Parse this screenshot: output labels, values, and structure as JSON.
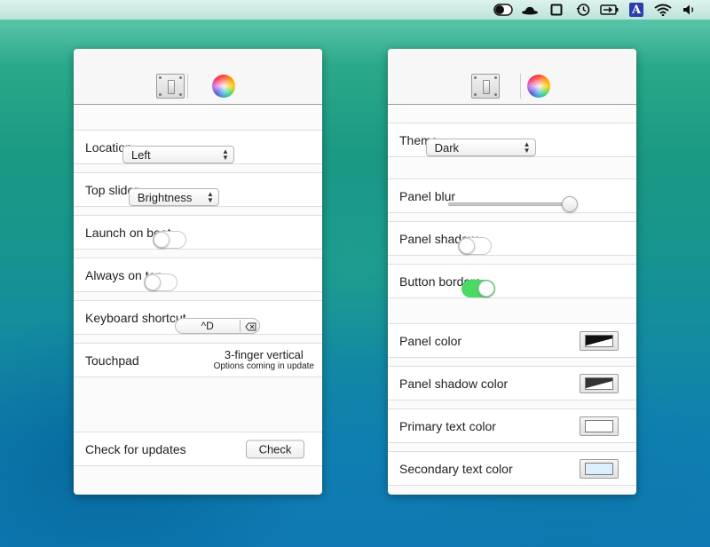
{
  "menubar": {
    "icons": [
      "toggle-icon",
      "bowler-hat-icon",
      "square-icon",
      "time-machine-icon",
      "battery-icon",
      "a-icon",
      "wifi-icon",
      "volume-icon"
    ],
    "a_glyph": "A"
  },
  "left_panel": {
    "location": {
      "label": "Location",
      "value": "Left"
    },
    "top_slider": {
      "label": "Top slider",
      "value": "Brightness"
    },
    "launch_on_boot": {
      "label": "Launch on boot",
      "on": false
    },
    "always_on_top": {
      "label": "Always on top",
      "on": false
    },
    "keyboard_shortcut": {
      "label": "Keyboard shortcut",
      "value": "^D"
    },
    "touchpad": {
      "label": "Touchpad",
      "value": "3-finger vertical",
      "note": "Options coming in update"
    },
    "check_for_updates": {
      "label": "Check for updates",
      "button": "Check"
    }
  },
  "right_panel": {
    "theme": {
      "label": "Theme",
      "value": "Dark"
    },
    "panel_blur": {
      "label": "Panel blur",
      "value": 1.0
    },
    "panel_shadow": {
      "label": "Panel shadow",
      "on": false
    },
    "button_borders": {
      "label": "Button borders",
      "on": true
    },
    "panel_color": {
      "label": "Panel color"
    },
    "panel_shadow_color": {
      "label": "Panel shadow color"
    },
    "primary_text_color": {
      "label": "Primary text color",
      "color": "#ffffff"
    },
    "secondary_text_color": {
      "label": "Secondary text color",
      "color": "#dcefff"
    }
  },
  "colors": {
    "toggle_on": "#4cd964",
    "swatch_dark": "#111111",
    "swatch_shadow": "#333333"
  }
}
